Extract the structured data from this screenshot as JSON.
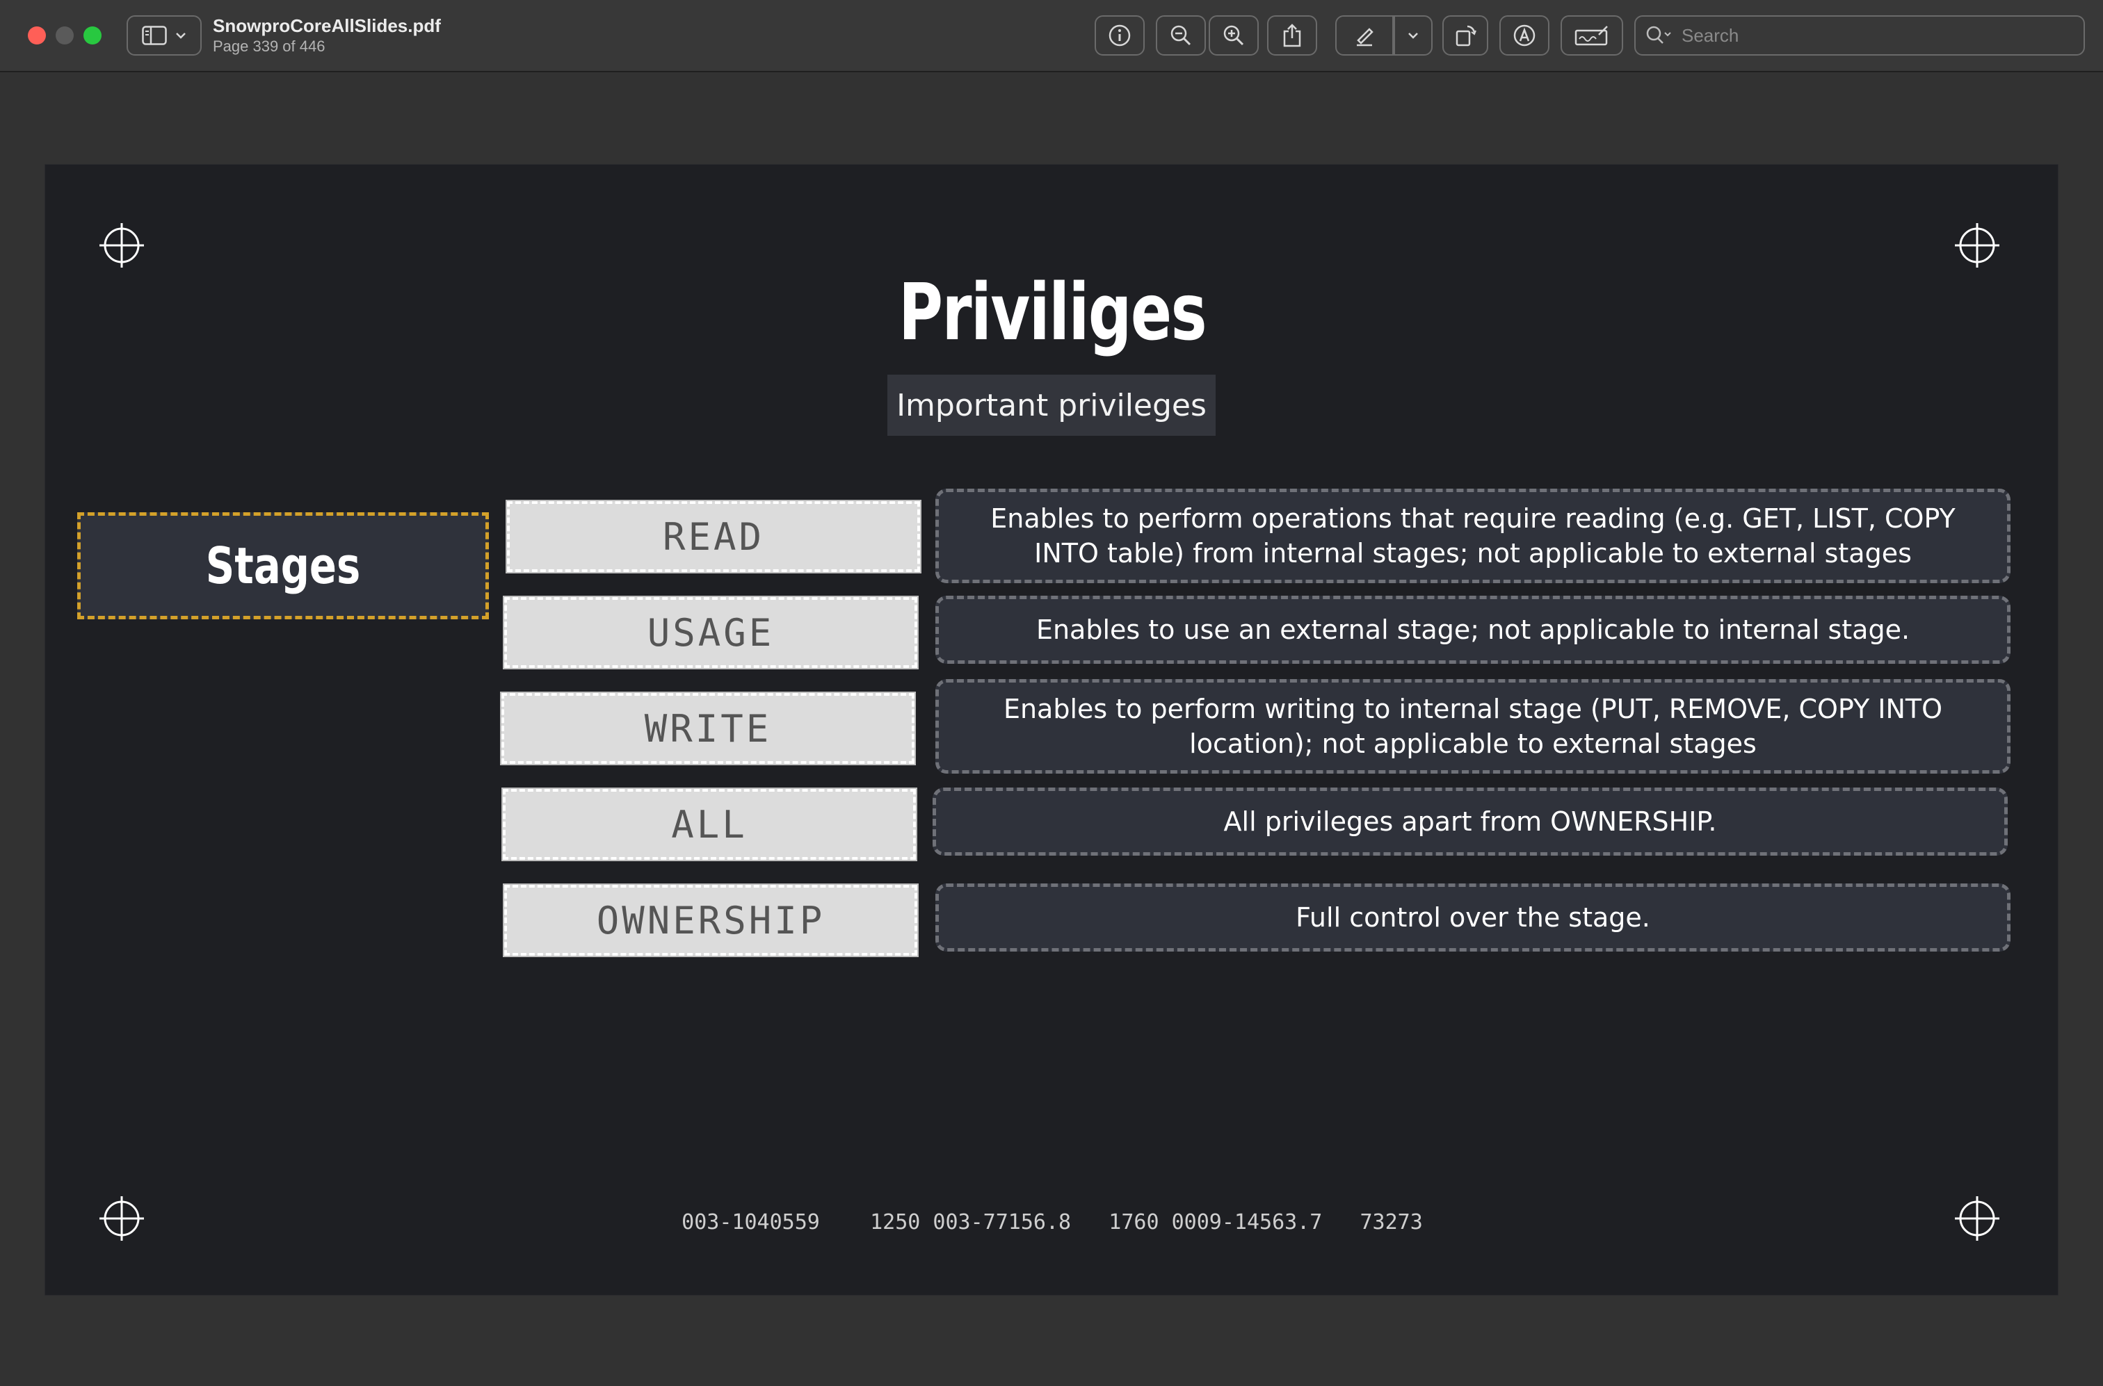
{
  "window": {
    "file_name": "SnowproCoreAllSlides.pdf",
    "page_indicator": "Page 339 of 446"
  },
  "toolbar": {
    "icons": [
      "sidebar-icon",
      "chevron-down-icon",
      "info-icon",
      "zoom-out-icon",
      "zoom-in-icon",
      "share-icon",
      "pen-icon",
      "chevron-down-icon",
      "rotate-icon",
      "markup-icon",
      "signature-icon",
      "search-icon"
    ],
    "search_placeholder": "Search"
  },
  "slide": {
    "title": "Priviliges",
    "subtitle": "Important privileges",
    "category": "Stages",
    "rows": [
      {
        "privilege": "READ",
        "description": "Enables to perform operations that require reading (e.g. GET, LIST, COPY INTO table) from internal stages; not applicable to external stages"
      },
      {
        "privilege": "USAGE",
        "description": "Enables to use an external stage; not applicable to internal stage."
      },
      {
        "privilege": "WRITE",
        "description": "Enables to perform writing to internal stage (PUT, REMOVE, COPY INTO location); not applicable to external stages"
      },
      {
        "privilege": "ALL",
        "description": "All privileges apart from OWNERSHIP."
      },
      {
        "privilege": "OWNERSHIP",
        "description": "Full control over the stage."
      }
    ],
    "footer_codes": "003-1040559    1250 003-77156.8   1760 0009-14563.7   73273"
  },
  "colors": {
    "accent_border": "#d4a12a",
    "slide_background": "#1e1f23",
    "box_background": "#2f323b"
  }
}
